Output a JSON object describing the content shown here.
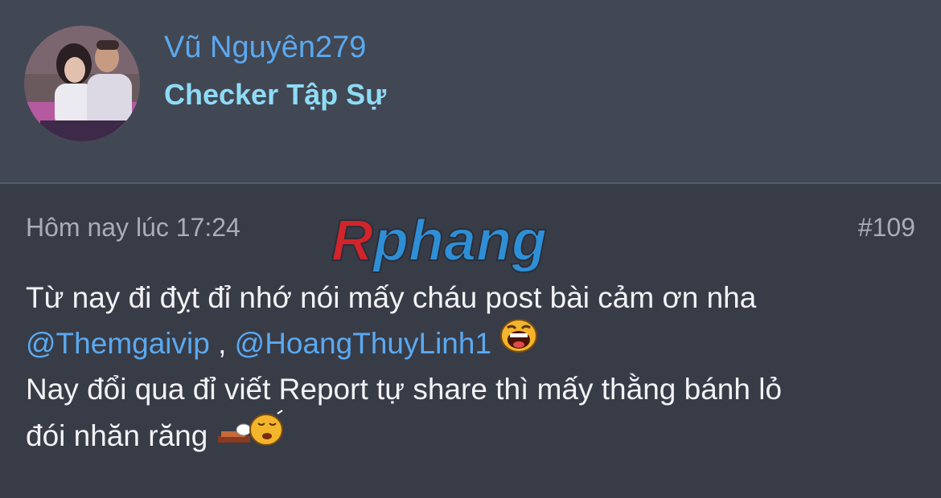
{
  "user": {
    "name": "Vũ Nguyên279",
    "rank": "Checker Tập Sự"
  },
  "post": {
    "time": "Hôm nay lúc 17:24",
    "number": "#109",
    "line1": "Từ nay đi đỵt đỉ nhớ nói mấy cháu post bài cảm ơn nha",
    "mention1": "@Themgaivip",
    "separator": " , ",
    "mention2": "@HoangThuyLinh1",
    "line3": "Nay đổi qua đỉ viết Report tự share thì mấy thằng bánh lỏ",
    "line4": "đói nhăn răng"
  },
  "watermark": {
    "text": "Rphang"
  },
  "colors": {
    "background": "#383c47",
    "header": "#424754",
    "username": "#5aa9f0",
    "rank": "#8ddcf6",
    "mention": "#5aa9f0",
    "watermark_red": "#d2242b",
    "watermark_blue": "#2f8fd6"
  },
  "icons": [
    "user-avatar",
    "laughing-emoji-icon",
    "sleeping-emoji-icon"
  ]
}
